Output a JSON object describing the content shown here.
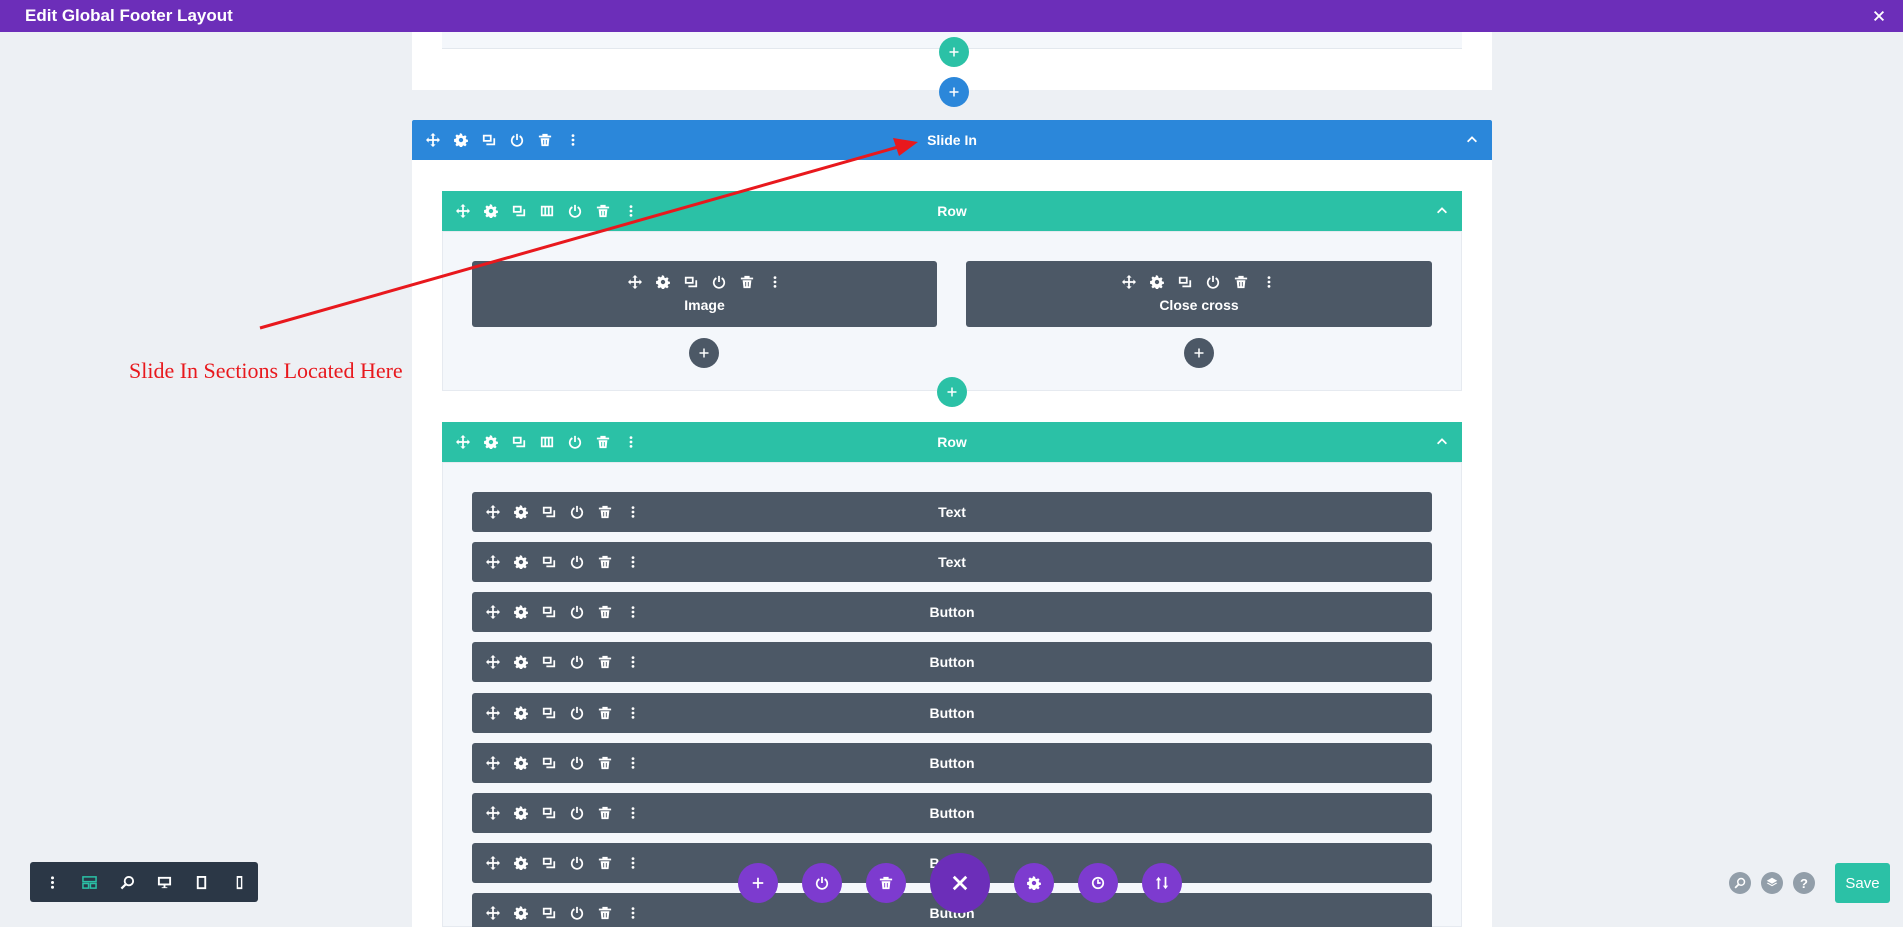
{
  "topbar": {
    "title": "Edit Global Footer Layout",
    "close_icon": "close-icon"
  },
  "section": {
    "label": "Slide In"
  },
  "row1": {
    "label": "Row",
    "modules": [
      {
        "label": "Image"
      },
      {
        "label": "Close cross"
      }
    ]
  },
  "row2": {
    "label": "Row",
    "modules": [
      {
        "label": "Text"
      },
      {
        "label": "Text"
      },
      {
        "label": "Button"
      },
      {
        "label": "Button"
      },
      {
        "label": "Button"
      },
      {
        "label": "Button"
      },
      {
        "label": "Button"
      },
      {
        "label": "Button"
      },
      {
        "label": "Button"
      }
    ]
  },
  "annotation": {
    "text": "Slide In Sections Located Here"
  },
  "footer": {
    "save_label": "Save"
  },
  "colors": {
    "topbar": "#6c2eb9",
    "section": "#2b87da",
    "row": "#2bc1a6",
    "module": "#4c5866",
    "annotation": "#e8181d",
    "save": "#2bc1a6"
  }
}
